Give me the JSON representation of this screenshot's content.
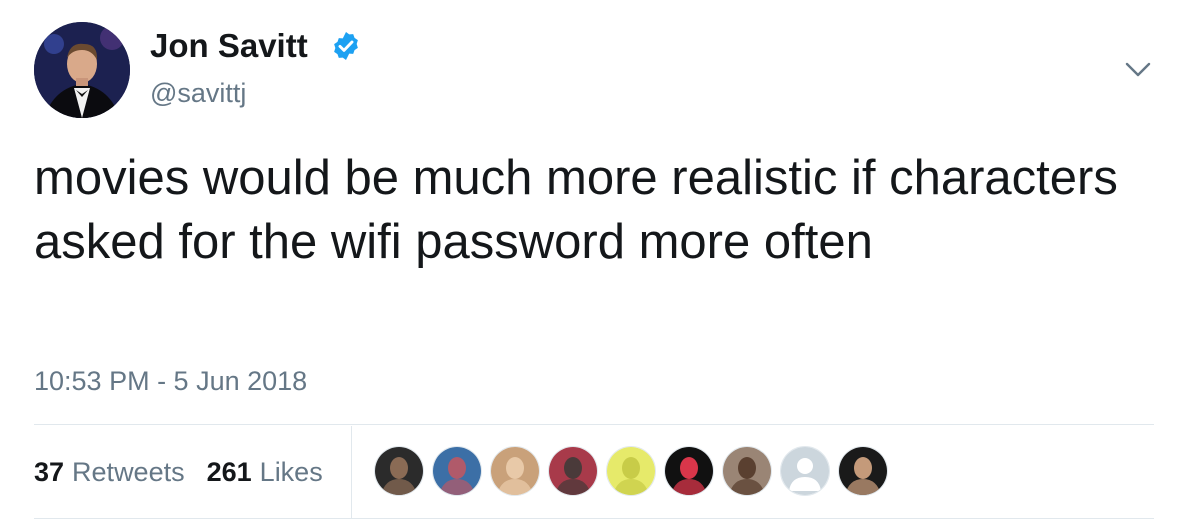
{
  "user": {
    "display_name": "Jon Savitt",
    "handle": "@savittj",
    "verified": true
  },
  "tweet": {
    "text": "movies would be much more realistic if characters asked for the wifi password more often",
    "timestamp": "10:53 PM - 5 Jun 2018"
  },
  "stats": {
    "retweets_count": "37",
    "retweets_label": "Retweets",
    "likes_count": "261",
    "likes_label": "Likes"
  },
  "likers": [
    {
      "icon": "liker-avatar",
      "bg": "#2b2b2b",
      "fg": "#8a6b55"
    },
    {
      "icon": "liker-avatar",
      "bg": "#3c6fa6",
      "fg": "#b05a6a"
    },
    {
      "icon": "liker-avatar",
      "bg": "#c9a17a",
      "fg": "#e8c9a8"
    },
    {
      "icon": "liker-avatar",
      "bg": "#a83a4a",
      "fg": "#4a3a3a"
    },
    {
      "icon": "liker-avatar",
      "bg": "#e6ea6a",
      "fg": "#c8cc48"
    },
    {
      "icon": "liker-avatar",
      "bg": "#111111",
      "fg": "#d9364a"
    },
    {
      "icon": "liker-avatar",
      "bg": "#9a8575",
      "fg": "#5a4030"
    },
    {
      "icon": "default-avatar-icon",
      "bg": "#ccd6dd",
      "fg": "#ffffff"
    },
    {
      "icon": "liker-avatar",
      "bg": "#1a1a1a",
      "fg": "#c49a7a"
    }
  ],
  "colors": {
    "text_primary": "#14171a",
    "text_secondary": "#657786",
    "verified_blue": "#1da1f2",
    "divider": "#e1e8ed"
  },
  "icons": {
    "verified": "verified-badge-icon",
    "caret": "chevron-down-icon"
  }
}
